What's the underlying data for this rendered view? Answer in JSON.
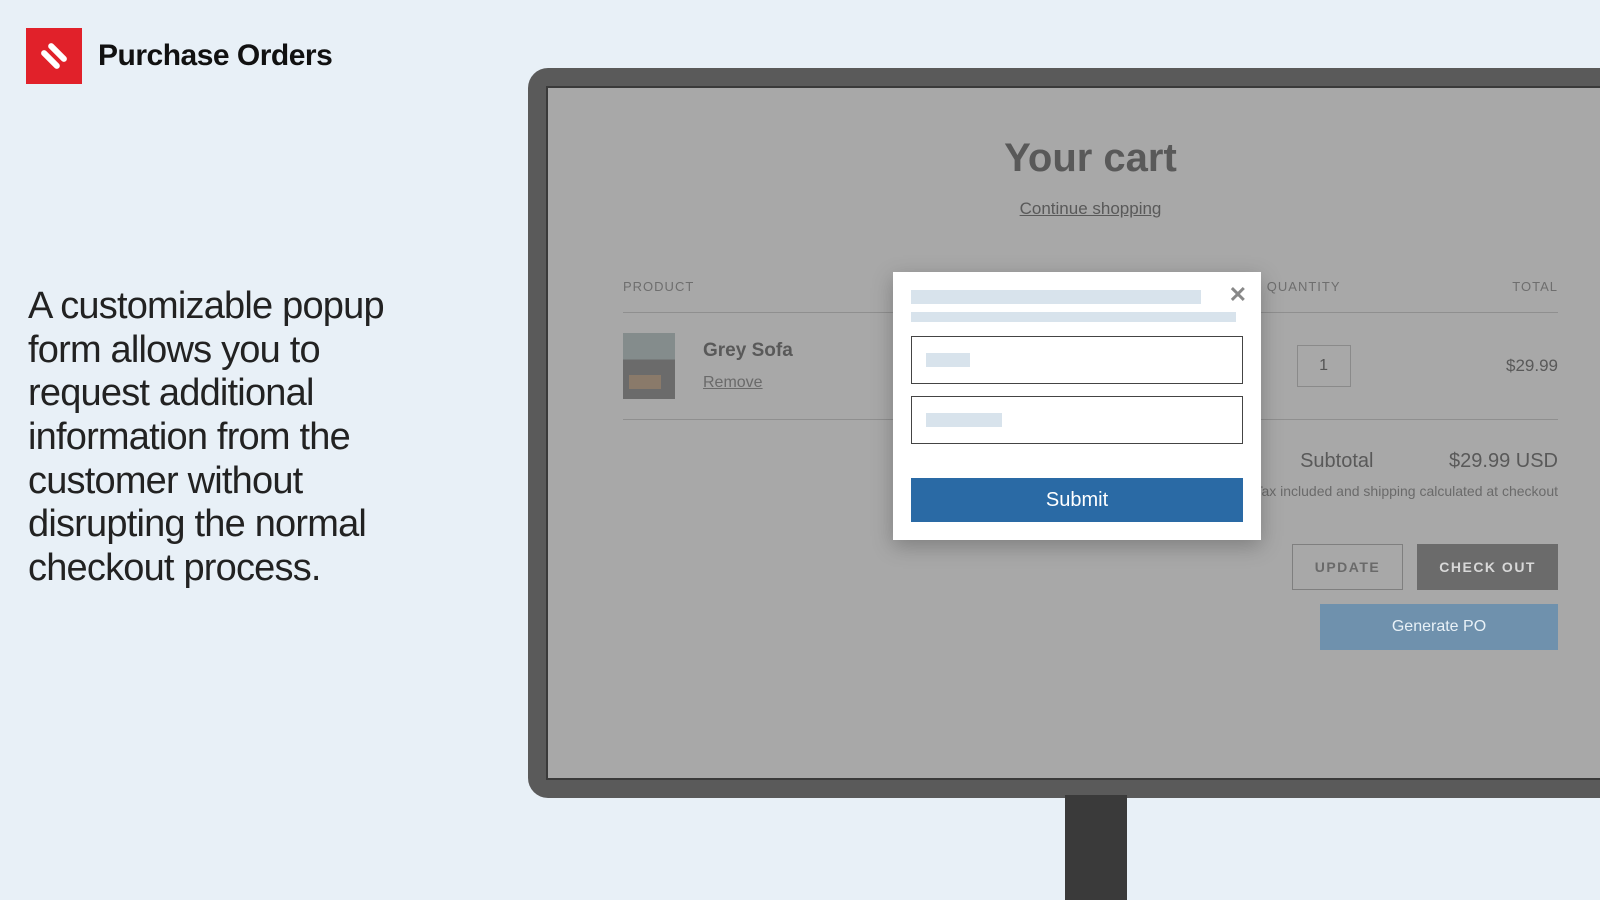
{
  "brand": {
    "title": "Purchase Orders"
  },
  "marketing": {
    "text": "A customizable popup form allows you to request additional information from the customer without disrupting the normal checkout process."
  },
  "cart": {
    "title": "Your cart",
    "continue_label": "Continue shopping",
    "columns": {
      "product": "PRODUCT",
      "quantity": "QUANTITY",
      "total": "TOTAL"
    },
    "item": {
      "name": "Grey Sofa",
      "remove_label": "Remove",
      "quantity": "1",
      "price": "$29.99"
    },
    "subtotal_label": "Subtotal",
    "subtotal_value": "$29.99 USD",
    "tax_note": "Tax included and shipping calculated at checkout",
    "update_label": "UPDATE",
    "checkout_label": "CHECK OUT",
    "generate_po_label": "Generate PO"
  },
  "popup": {
    "submit_label": "Submit"
  }
}
